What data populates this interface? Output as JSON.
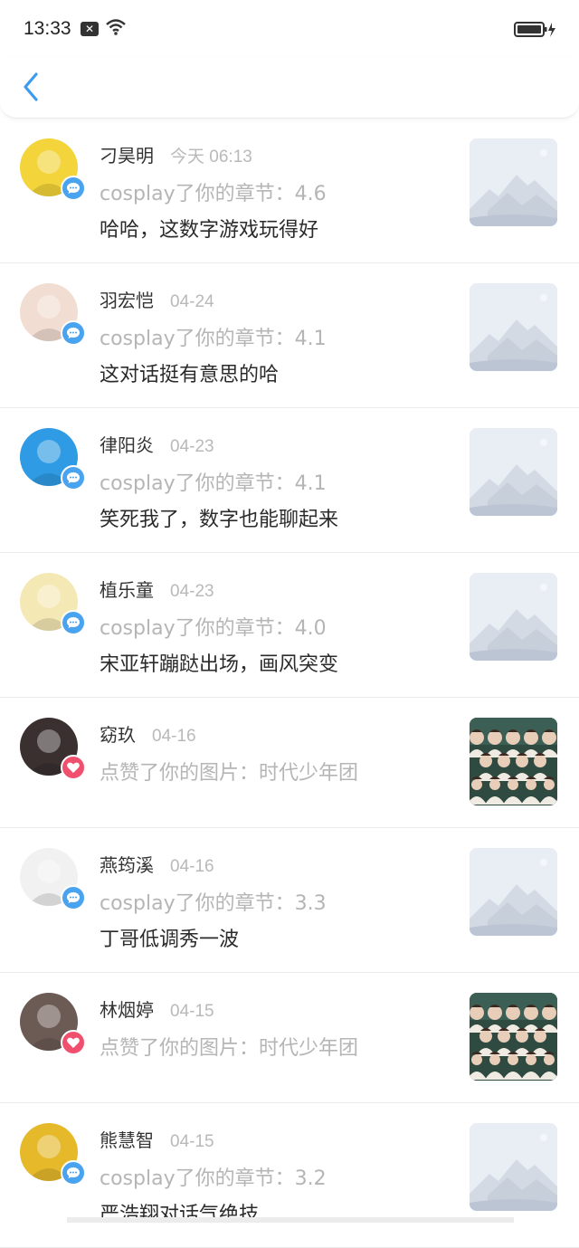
{
  "status_bar": {
    "time": "13:33"
  },
  "notifications": [
    {
      "name": "刁昊明",
      "time": "今天 06:13",
      "type": "comment",
      "action": "cosplay了你的章节：4.6",
      "content": "哈哈，这数字游戏玩得好",
      "thumb": "placeholder",
      "avatar_color": "#f3d43a"
    },
    {
      "name": "羽宏恺",
      "time": "04-24",
      "type": "comment",
      "action": "cosplay了你的章节：4.1",
      "content": "这对话挺有意思的哈",
      "thumb": "placeholder",
      "avatar_color": "#f2ddd2"
    },
    {
      "name": "律阳炎",
      "time": "04-23",
      "type": "comment",
      "action": "cosplay了你的章节：4.1",
      "content": "笑死我了，数字也能聊起来",
      "thumb": "placeholder",
      "avatar_color": "#2f9be4"
    },
    {
      "name": "植乐童",
      "time": "04-23",
      "type": "comment",
      "action": "cosplay了你的章节：4.0",
      "content": "宋亚轩蹦跶出场，画风突变",
      "thumb": "placeholder",
      "avatar_color": "#f4e9b4"
    },
    {
      "name": "窈玖",
      "time": "04-16",
      "type": "like",
      "action": "点赞了你的图片：时代少年团",
      "content": "",
      "thumb": "photo",
      "avatar_color": "#3a3030"
    },
    {
      "name": "燕筠溪",
      "time": "04-16",
      "type": "comment",
      "action": "cosplay了你的章节：3.3",
      "content": "丁哥低调秀一波",
      "thumb": "placeholder",
      "avatar_color": "#f1f1f1"
    },
    {
      "name": "林烟婷",
      "time": "04-15",
      "type": "like",
      "action": "点赞了你的图片：时代少年团",
      "content": "",
      "thumb": "photo",
      "avatar_color": "#6c5a55"
    },
    {
      "name": "熊慧智",
      "time": "04-15",
      "type": "comment",
      "action": "cosplay了你的章节：3.2",
      "content": "严浩翔对话气绝技",
      "thumb": "placeholder",
      "avatar_color": "#e6b92b"
    }
  ],
  "colors": {
    "accent": "#3d9bf0",
    "comment_badge": "#4aa3ee",
    "like_badge": "#f0506e"
  }
}
